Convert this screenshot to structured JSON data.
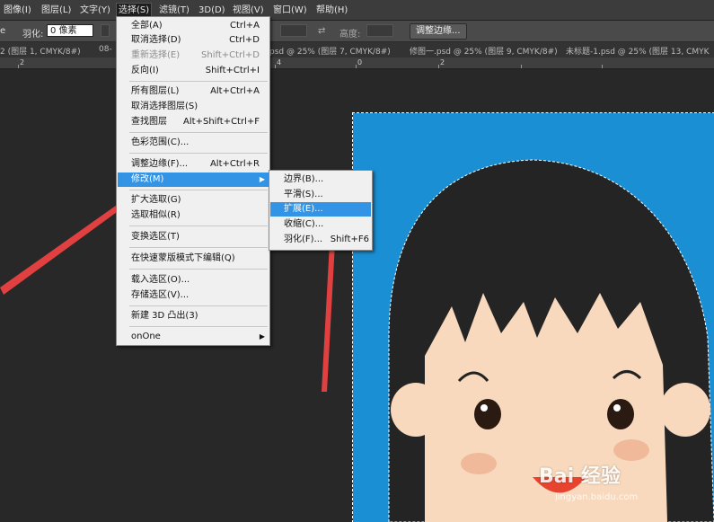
{
  "menubar": {
    "items": [
      "图像(I)",
      "图层(L)",
      "文字(Y)",
      "选择(S)",
      "滤镜(T)",
      "3D(D)",
      "视图(V)",
      "窗口(W)",
      "帮助(H)"
    ]
  },
  "options": {
    "feather_label": "羽化:",
    "feather_value": "0 像素",
    "height_label": "高度:",
    "refine_button": "调整边缘..."
  },
  "tabs": [
    "2 (图层 1, CMYK/8#)",
    "08-",
    "psd @ 25% (图层 7, CMYK/8#)",
    "修图一.psd @ 25% (图层 9, CMYK/8#)",
    "未标题-1.psd @ 25% (图层 13, CMYK"
  ],
  "ruler": {
    "labels": [
      "2",
      "4",
      "0",
      "2"
    ]
  },
  "select_menu": {
    "items": [
      {
        "label": "全部(A)",
        "shortcut": "Ctrl+A"
      },
      {
        "label": "取消选择(D)",
        "shortcut": "Ctrl+D"
      },
      {
        "label": "重新选择(E)",
        "shortcut": "Shift+Ctrl+D"
      },
      {
        "label": "反向(I)",
        "shortcut": "Shift+Ctrl+I"
      },
      {
        "label": "所有图层(L)",
        "shortcut": "Alt+Ctrl+A"
      },
      {
        "label": "取消选择图层(S)",
        "shortcut": ""
      },
      {
        "label": "查找图层",
        "shortcut": "Alt+Shift+Ctrl+F"
      },
      {
        "label": "色彩范围(C)...",
        "shortcut": ""
      },
      {
        "label": "调整边缘(F)...",
        "shortcut": "Alt+Ctrl+R"
      },
      {
        "label": "修改(M)",
        "shortcut": ""
      },
      {
        "label": "扩大选取(G)",
        "shortcut": ""
      },
      {
        "label": "选取相似(R)",
        "shortcut": ""
      },
      {
        "label": "变换选区(T)",
        "shortcut": ""
      },
      {
        "label": "在快速蒙版模式下编辑(Q)",
        "shortcut": ""
      },
      {
        "label": "载入选区(O)...",
        "shortcut": ""
      },
      {
        "label": "存储选区(V)...",
        "shortcut": ""
      },
      {
        "label": "新建 3D 凸出(3)",
        "shortcut": ""
      },
      {
        "label": "onOne",
        "shortcut": ""
      }
    ]
  },
  "modify_menu": {
    "items": [
      {
        "label": "边界(B)...",
        "shortcut": ""
      },
      {
        "label": "平滑(S)...",
        "shortcut": ""
      },
      {
        "label": "扩展(E)...",
        "shortcut": ""
      },
      {
        "label": "收缩(C)...",
        "shortcut": ""
      },
      {
        "label": "羽化(F)...",
        "shortcut": "Shift+F6"
      }
    ]
  },
  "watermark": {
    "brand": "Bai 经验",
    "url": "jingyan.baidu.com"
  },
  "colors": {
    "canvas_bg": "#1b8fd4",
    "menu_highlight": "#3393e5",
    "arrow_red": "#e04040"
  }
}
